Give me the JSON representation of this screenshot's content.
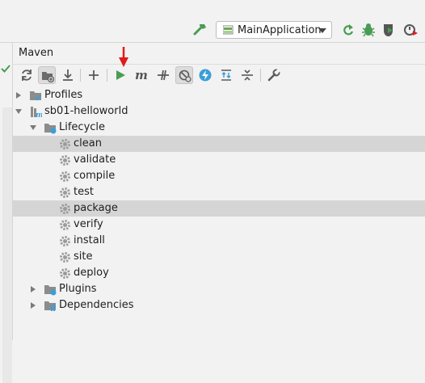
{
  "run_toolbar": {
    "run_config": "MainApplication",
    "icons": [
      "hammer-icon",
      "rerun-icon",
      "debug-icon",
      "coverage-icon",
      "profile-icon"
    ]
  },
  "panel": {
    "title": "Maven",
    "toolbar": [
      "refresh-icon",
      "folder-plus-icon",
      "download-icon",
      "add-icon",
      "run-icon",
      "maven-m-icon",
      "toggle-offline-icon",
      "skip-tests-icon",
      "lightning-icon",
      "show-dependencies-icon",
      "collapse-all-icon",
      "wrench-icon"
    ]
  },
  "tree": {
    "profiles": "Profiles",
    "project": "sb01-helloworld",
    "lifecycle": "Lifecycle",
    "goals": [
      "clean",
      "validate",
      "compile",
      "test",
      "package",
      "verify",
      "install",
      "site",
      "deploy"
    ],
    "selected_goals": [
      "clean",
      "package"
    ],
    "plugins": "Plugins",
    "dependencies": "Dependencies"
  },
  "colors": {
    "accent_green": "#499c54",
    "annotation_red": "#e01b1b",
    "selection": "#d5d5d5"
  }
}
